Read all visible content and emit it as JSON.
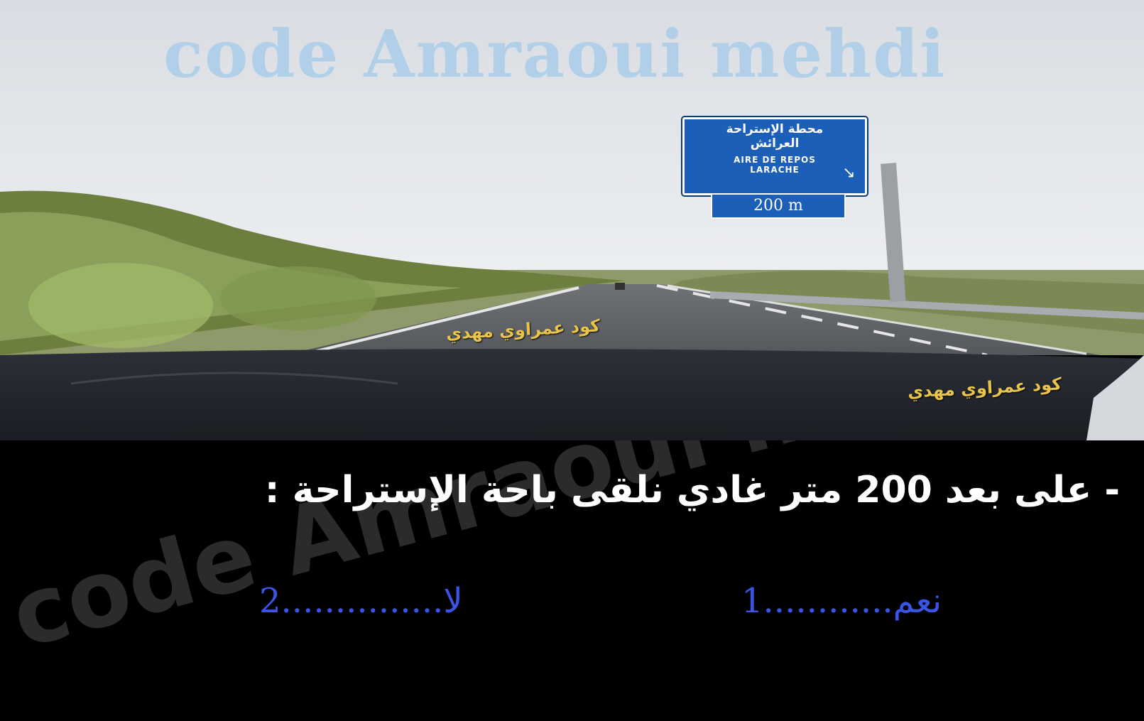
{
  "watermark_top": "code Amraoui mehdi",
  "sign": {
    "arabic_line1": "محطة الإستراحة",
    "arabic_line2": "العرائش",
    "french_line1": "AIRE DE REPOS",
    "french_line2": "LARACHE",
    "distance": "200 m",
    "arrow_icon": "diagonal-arrow-icon"
  },
  "watermark_road": "كود عمراوي مهدي",
  "watermark_dashboard": "كود عمراوي مهدي",
  "watermark_panel": "code Amraoui mehdi",
  "question": "- على بعد 200 متر غادي نلقى باحة الإستراحة :",
  "options": [
    {
      "label": "نعم............1"
    },
    {
      "label": "لا...............2"
    }
  ],
  "colors": {
    "sign_blue": "#1b5fb8",
    "option_blue": "#3a55e6",
    "watermark_gold": "#e8c44a"
  }
}
